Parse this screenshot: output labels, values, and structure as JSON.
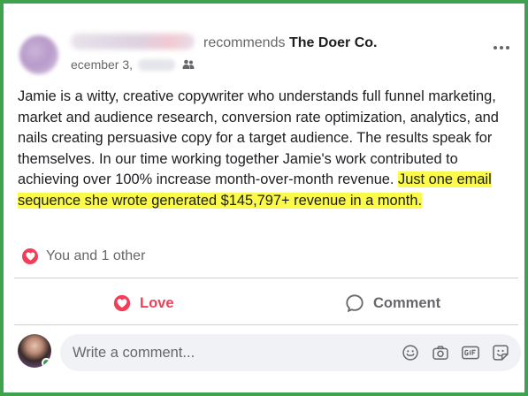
{
  "post": {
    "author_obscured": true,
    "recommends_text": "recommends",
    "page_name": "The Doer Co.",
    "date_text": "ecember 3,",
    "audience_icon": "friends-icon",
    "text_plain": "Jamie is a witty, creative copywriter who understands full funnel marketing, market and audience research, conversion rate optimization, analytics, and nails creating persuasive copy for a target audience. The results speak for themselves. In our time working together Jamie's work contributed to achieving over 100% increase month-over-month revenue. ",
    "text_highlight": "Just one email sequence she wrote generated $145,797+ revenue in a month.",
    "highlight_color": "#fbf94a"
  },
  "reactions": {
    "icon": "heart-icon",
    "summary": "You and 1 other",
    "color": "#f33e58"
  },
  "actions": {
    "love_label": "Love",
    "comment_label": "Comment"
  },
  "composer": {
    "placeholder": "Write a comment...",
    "tools": [
      "emoji-icon",
      "camera-icon",
      "gif-icon",
      "sticker-icon"
    ]
  },
  "colors": {
    "frame_border": "#3fa34d",
    "text_primary": "#1c1e21",
    "text_secondary": "#65676b",
    "love_red": "#f33e58",
    "input_bg": "#f0f2f5"
  }
}
